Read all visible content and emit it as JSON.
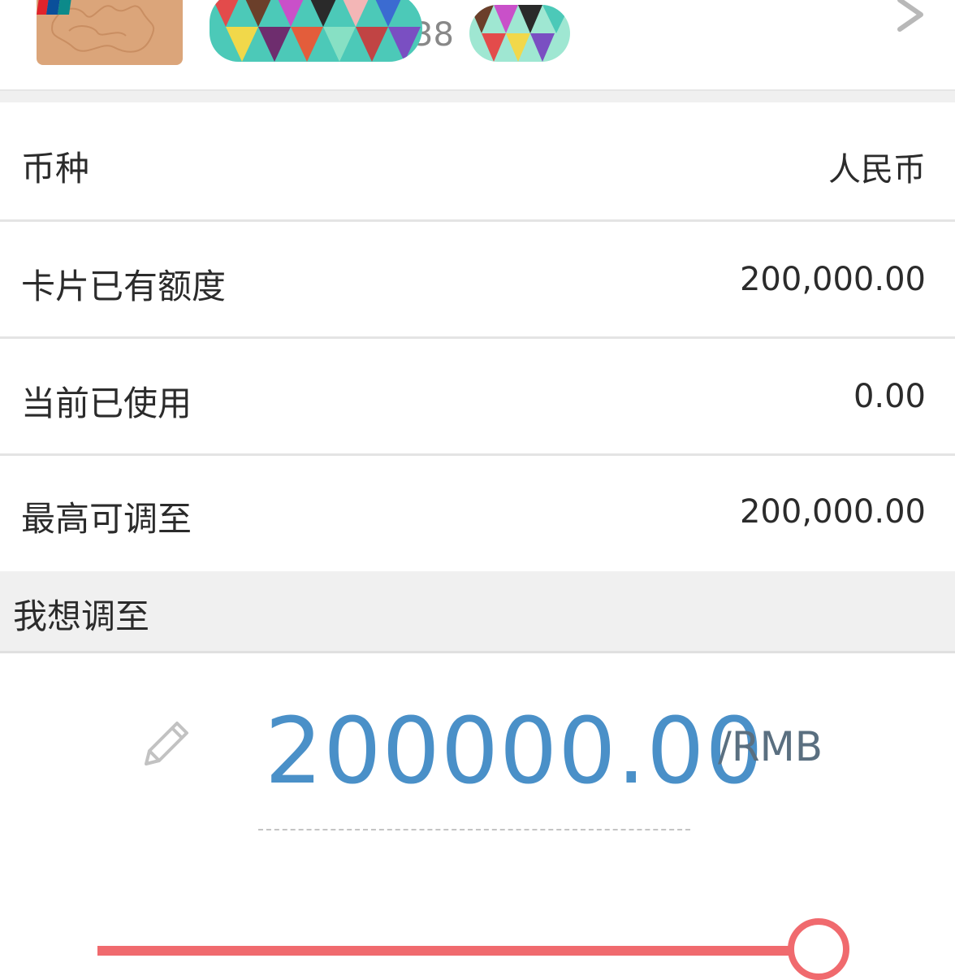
{
  "card": {
    "name_visible": "",
    "number_fragment": "38",
    "network_logo_icon": "unionpay-logo",
    "accent_color": "#dba57a"
  },
  "info_rows": [
    {
      "label": "币种",
      "value": "人民币"
    },
    {
      "label": "卡片已有额度",
      "value": "200,000.00"
    },
    {
      "label": "当前已使用",
      "value": "0.00"
    },
    {
      "label": "最高可调至",
      "value": "200,000.00"
    }
  ],
  "adjust": {
    "section_title": "我想调至",
    "amount": "200000.00",
    "unit": "/RMB",
    "edit_icon": "pencil-icon",
    "amount_color": "#4a90c8"
  },
  "slider": {
    "level": 1.0,
    "color": "#f06a6e"
  }
}
